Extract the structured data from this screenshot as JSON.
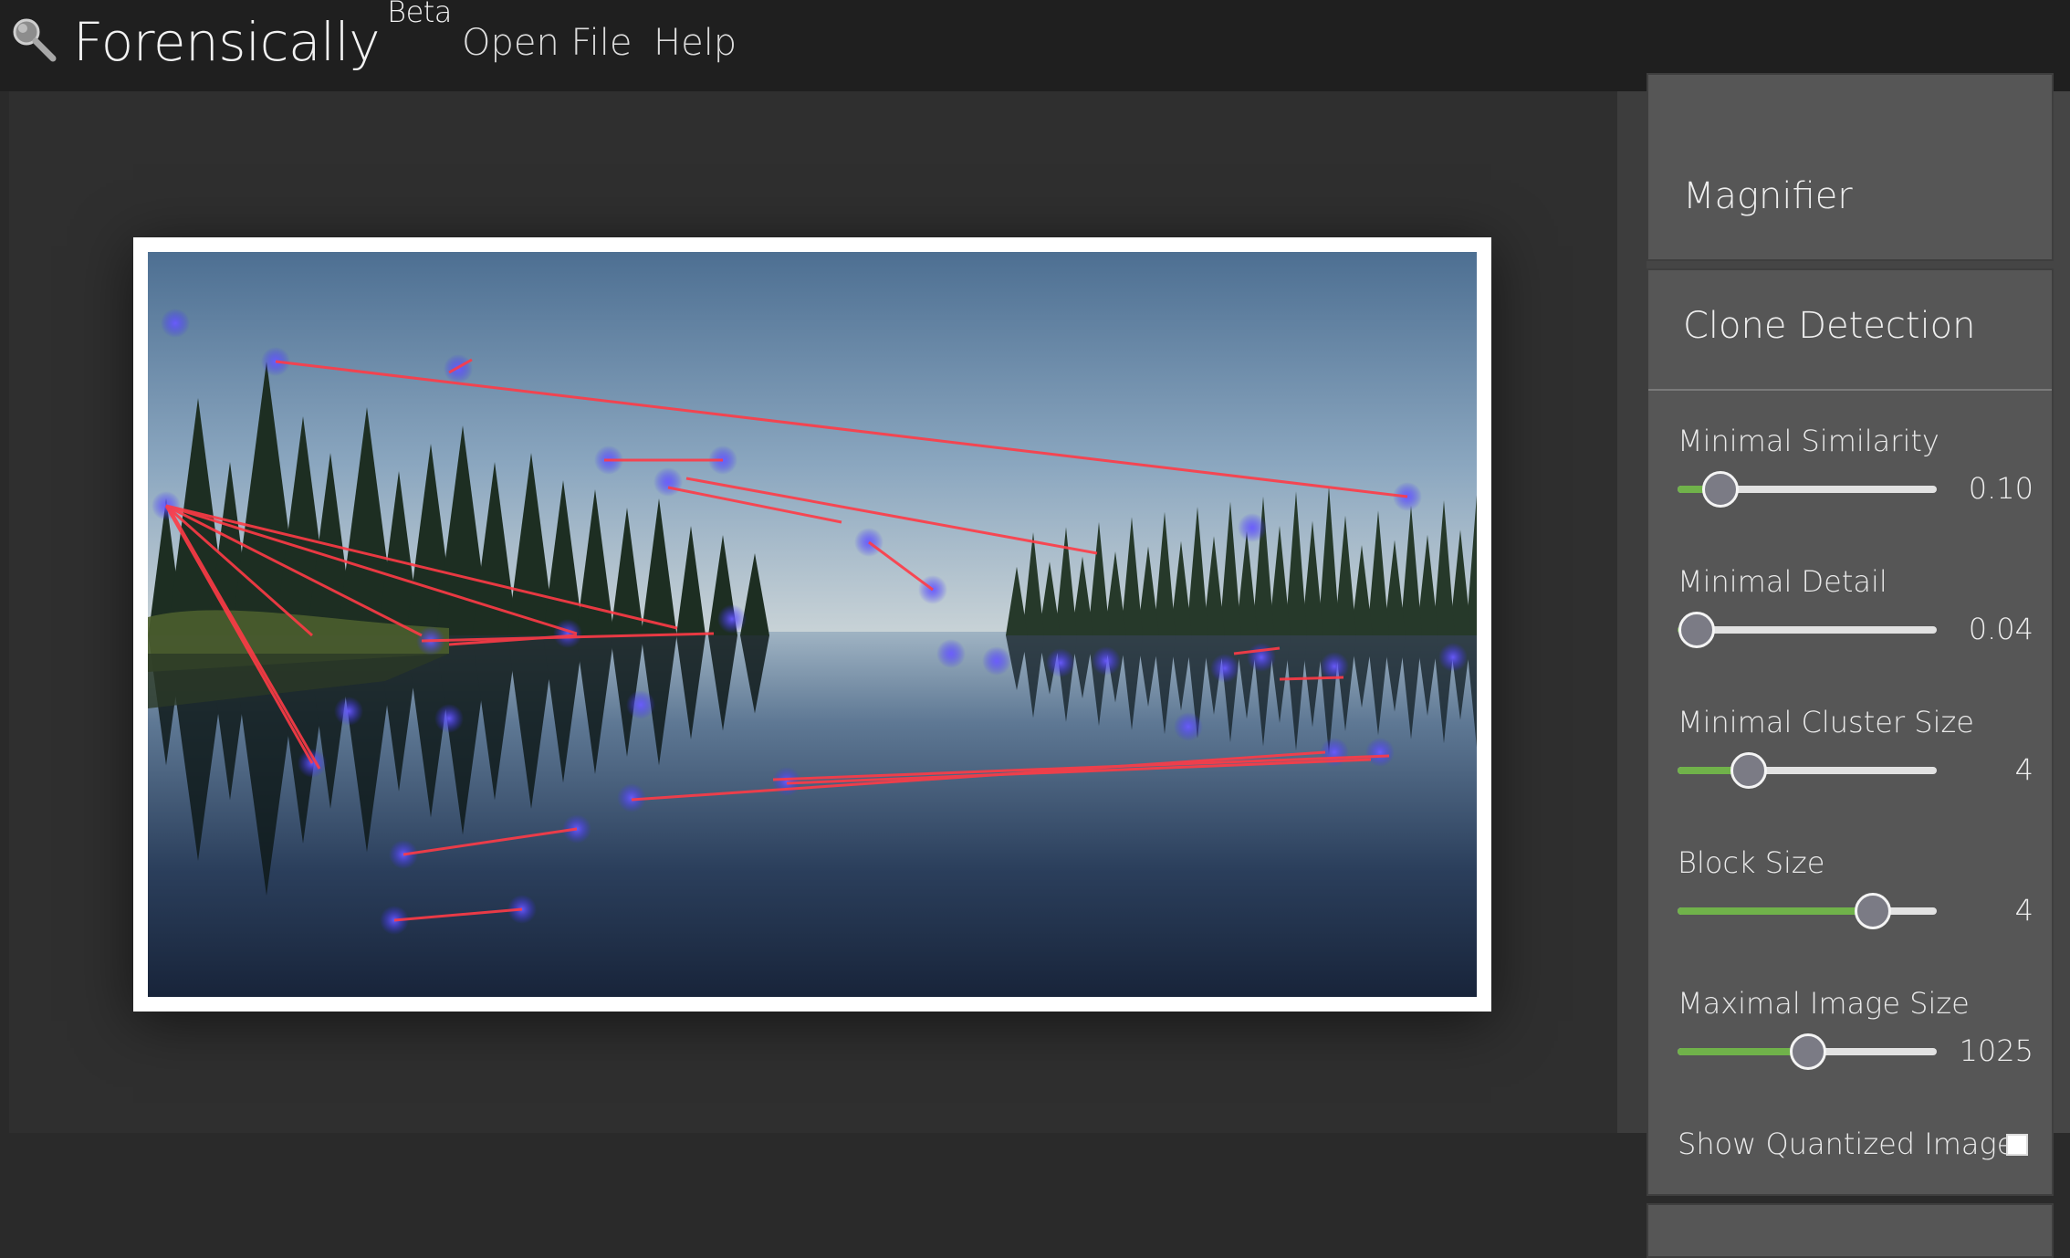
{
  "app": {
    "title": "Forensically",
    "title_sup": "Beta",
    "logo_icon": "magnifier-icon",
    "nav": [
      {
        "label": "Open File"
      },
      {
        "label": "Help"
      }
    ]
  },
  "sidebar": {
    "magnifier": {
      "title": "Magnifier"
    },
    "clone_detection": {
      "title": "Clone Detection",
      "controls": [
        {
          "label": "Minimal Similarity",
          "value": "0.10",
          "position": 0.13
        },
        {
          "label": "Minimal Detail",
          "value": "0.04",
          "position": 0.04
        },
        {
          "label": "Minimal Cluster Size",
          "value": "4",
          "position": 0.24
        },
        {
          "label": "Block Size",
          "value": "4",
          "position": 0.72
        },
        {
          "label": "Maximal Image Size",
          "value": "1025",
          "position": 0.47
        }
      ],
      "show_quantized": {
        "label": "Show Quantized Image",
        "checked": false
      }
    }
  },
  "colors": {
    "slider_fill": "#70b24a",
    "clone_line": "#ff3b46",
    "clone_marker": "#4a3cff"
  }
}
